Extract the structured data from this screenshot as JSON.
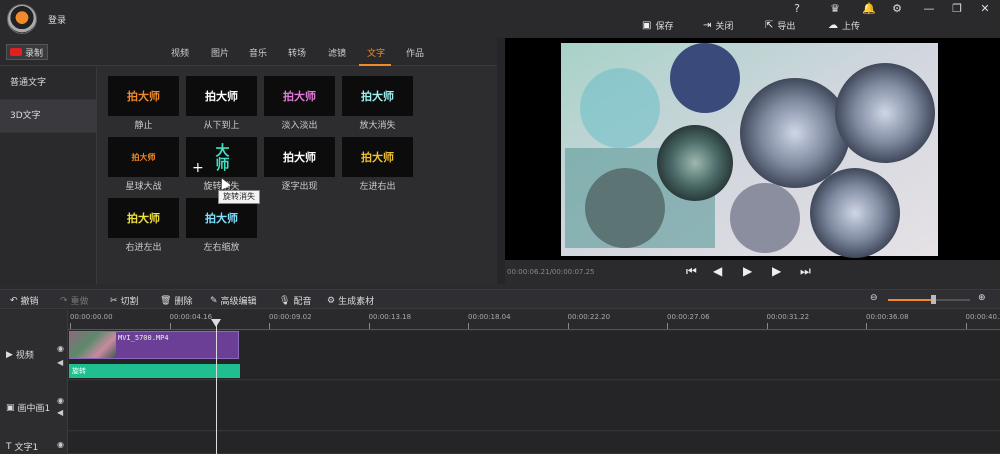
{
  "header": {
    "login_label": "登录",
    "window_buttons": [
      "?",
      "♛",
      "🔔",
      "⚙",
      "—",
      "❐",
      "✕"
    ],
    "actions": [
      {
        "icon": "save-icon",
        "label": "保存"
      },
      {
        "icon": "exit-icon",
        "label": "关闭"
      },
      {
        "icon": "export-icon",
        "label": "导出"
      },
      {
        "icon": "upload-icon",
        "label": "上传"
      }
    ]
  },
  "record_label": "录制",
  "tabs": [
    "视频",
    "图片",
    "音乐",
    "转场",
    "滤镜",
    "文字",
    "作品"
  ],
  "active_tab": "文字",
  "categories": [
    "普通文字",
    "3D文字"
  ],
  "effects": [
    {
      "thumb": "拍大师",
      "label": "静止"
    },
    {
      "thumb": "拍大师",
      "label": "从下到上"
    },
    {
      "thumb": "拍大师",
      "label": "淡入淡出"
    },
    {
      "thumb": "拍大师",
      "label": "放大消失"
    },
    {
      "thumb": "拍大师",
      "label": "星球大战"
    },
    {
      "thumb": "大师",
      "label": "旋转消失"
    },
    {
      "thumb": "拍大师",
      "label": "逐字出现"
    },
    {
      "thumb": "拍大师",
      "label": "左进右出"
    },
    {
      "thumb": "拍大师",
      "label": "右进左出"
    },
    {
      "thumb": "拍大师",
      "label": "左右缩放"
    }
  ],
  "tooltip": "旋转消失",
  "preview": {
    "timecode": "00:00:06.21/00:00:07.25"
  },
  "toolbar": {
    "undo": "撤销",
    "redo": "重做",
    "cut": "切割",
    "delete": "删除",
    "advanced_edit": "高级编辑",
    "dub": "配音",
    "generate": "生成素材"
  },
  "zoom_level": 0.55,
  "ruler_ticks": [
    "00:00:00.00",
    "00:00:04.16",
    "00:00:09.02",
    "00:00:13.18",
    "00:00:18.04",
    "00:00:22.20",
    "00:00:27.06",
    "00:00:31.22",
    "00:00:36.08",
    "00:00:40.2"
  ],
  "tracks": {
    "video": "视频",
    "pip": "画中画1",
    "text": "文字1"
  },
  "clip": {
    "name": "MVI_5700.MP4",
    "effect": "旋转"
  }
}
